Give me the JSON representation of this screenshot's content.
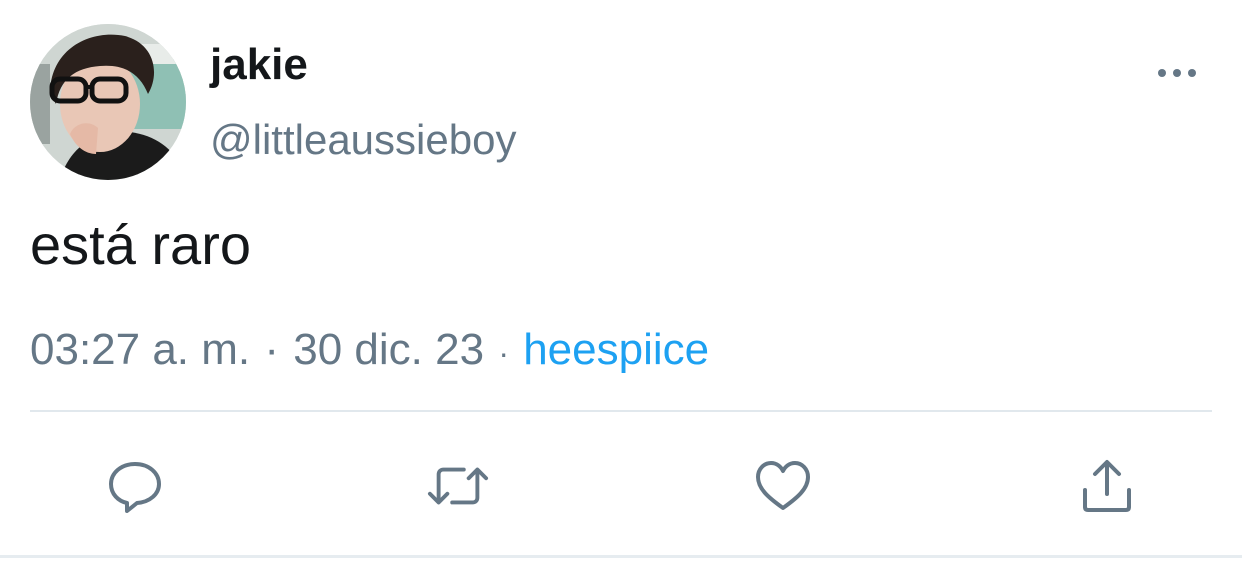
{
  "tweet": {
    "display_name": "jakie",
    "handle": "@littleaussieboy",
    "text": "está raro",
    "time": "03:27 a. m.",
    "separator": "·",
    "date": "30 dic. 23",
    "source": "heespiice"
  },
  "icons": {
    "more": "more-horizontal-icon",
    "reply": "reply-icon",
    "retweet": "retweet-icon",
    "like": "heart-icon",
    "share": "share-icon"
  },
  "colors": {
    "text": "#14171a",
    "secondary": "#657786",
    "link": "#1da1f2",
    "divider": "#e1e8ed"
  }
}
